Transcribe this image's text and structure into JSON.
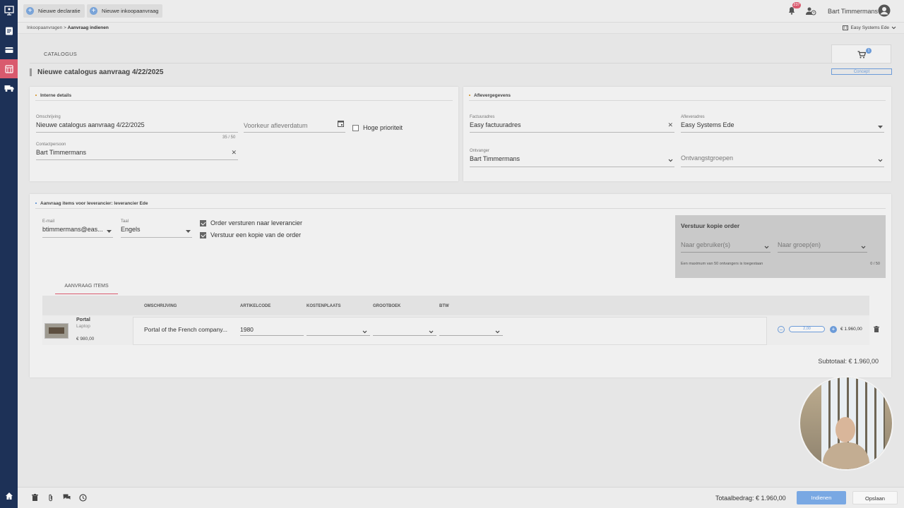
{
  "topbar": {
    "new_declaration": "Nieuwe declaratie",
    "new_purchase_request": "Nieuwe inkoopaanvraag",
    "notification_count": "237",
    "user_name": "Bart Timmermans"
  },
  "breadcrumb": {
    "parent": "Inkoopaanvragen",
    "separator": ">",
    "current": "Aanvraag indienen",
    "company": "Easy Systems Ede"
  },
  "header": {
    "tab": "CATALOGUS",
    "cart_count": "1",
    "title": "Nieuwe catalogus aanvraag 4/22/2025",
    "status": "Concept"
  },
  "internal": {
    "heading": "Interne details",
    "description_label": "Omschrijving",
    "description_value": "Nieuwe catalogus aanvraag 4/22/2025",
    "char_count": "35 / 50",
    "delivery_date_placeholder": "Voorkeur afleverdatum",
    "high_priority_label": "Hoge prioriteit",
    "contact_label": "Contactpersoon",
    "contact_value": "Bart Timmermans"
  },
  "delivery": {
    "heading": "Aflevergegevens",
    "invoice_address_label": "Factuuradres",
    "invoice_address_value": "Easy factuuradres",
    "delivery_address_label": "Afleveradres",
    "delivery_address_value": "Easy Systems Ede",
    "receiver_label": "Ontvanger",
    "receiver_value": "Bart Timmermans",
    "receiver_groups_placeholder": "Ontvangstgroepen"
  },
  "supplier": {
    "heading": "Aanvraag items voor leverancier: leverancier Ede",
    "email_label": "E-mail",
    "email_value": "btimmermans@eas...",
    "language_label": "Taal",
    "language_value": "Engels",
    "send_order_label": "Order versturen naar leverancier",
    "send_copy_label": "Verstuur een kopie van de order",
    "copy_title": "Verstuur kopie order",
    "to_user_placeholder": "Naar gebruiker(s)",
    "to_group_placeholder": "Naar groep(en)",
    "max_note": "Een maximum van 50 ontvangers is toegestaan",
    "recipient_count": "0 / 50"
  },
  "items": {
    "tab": "AANVRAAG ITEMS",
    "columns": [
      "OMSCHRIJVING",
      "ARTIKELCODE",
      "KOSTENPLAATS",
      "GROOTBOEK",
      "BTW"
    ],
    "rows": [
      {
        "product_name": "Portal",
        "product_category": "Laptop",
        "product_price": "€ 980,00",
        "description": "Portal of the French company...",
        "article_code": "1980",
        "cost_center": "",
        "ledger": "",
        "vat": "",
        "quantity": "2,00",
        "line_total": "€ 1.960,00"
      }
    ],
    "subtotal": "Subtotaal: € 1.960,00"
  },
  "footer": {
    "total": "Totaalbedrag: € 1.960,00",
    "submit_label": "Indienen",
    "save_label": "Opslaan"
  },
  "colors": {
    "rail": "#1d3157",
    "rail_active": "#d95a6e",
    "accent_blue": "#79a8e3"
  }
}
